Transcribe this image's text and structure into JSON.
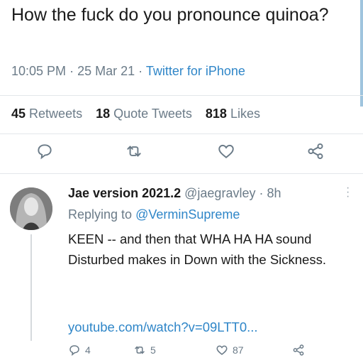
{
  "tweet": {
    "text": "How the fuck do you pronounce quinoa?",
    "time": "10:05 PM",
    "date": "25 Mar 21",
    "source": "Twitter for iPhone",
    "separator": "·"
  },
  "stats": {
    "retweets_count": "45",
    "retweets_label": "Retweets",
    "quotes_count": "18",
    "quotes_label": "Quote Tweets",
    "likes_count": "818",
    "likes_label": "Likes"
  },
  "actions": {
    "icons": [
      "reply-icon",
      "retweet-icon",
      "like-icon",
      "share-icon"
    ]
  },
  "reply": {
    "name": "Jae version 2021.2",
    "handle": "@jaegravley",
    "age": "8h",
    "replying_prefix": "Replying to",
    "replying_to": "@VerminSupreme",
    "text": "KEEN -- and then that WHA HA HA sound Disturbed makes in Down with the Sickness.",
    "link": "youtube.com/watch?v=09LTT0...",
    "reply_count": "4",
    "retweet_count": "5",
    "like_count": "87"
  },
  "colors": {
    "link": "#2f86c8",
    "muted": "#6b7b88",
    "text": "#1a1a1a"
  }
}
